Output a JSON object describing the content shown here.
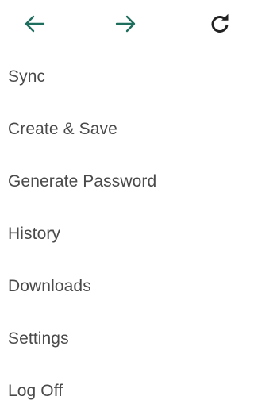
{
  "toolbar": {
    "back_icon": "arrow-left-icon",
    "forward_icon": "arrow-right-icon",
    "reload_icon": "reload-icon",
    "arrow_color": "#1e6e5e",
    "reload_color": "#222222"
  },
  "menu": {
    "items": [
      {
        "label": "Sync"
      },
      {
        "label": "Create & Save"
      },
      {
        "label": "Generate Password"
      },
      {
        "label": "History"
      },
      {
        "label": "Downloads"
      },
      {
        "label": "Settings"
      },
      {
        "label": "Log Off"
      }
    ]
  }
}
